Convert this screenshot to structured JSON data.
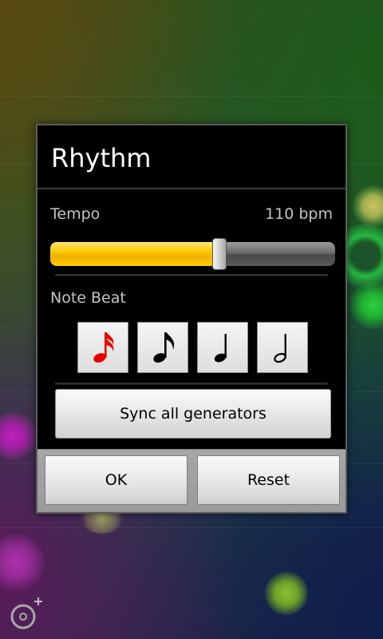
{
  "dialog": {
    "title": "Rhythm",
    "tempo": {
      "label": "Tempo",
      "value_text": "110 bpm",
      "slider_fraction": 0.595
    },
    "note_beat": {
      "label": "Note Beat",
      "selected": "sixteenth-note",
      "options": [
        "sixteenth-note",
        "eighth-note",
        "quarter-note",
        "half-note"
      ]
    },
    "sync_label": "Sync all generators",
    "buttons": {
      "ok_label": "OK",
      "reset_label": "Reset"
    }
  },
  "colors": {
    "slider_fill": "#ffcc00",
    "selected_note": "#e80000",
    "note": "#000000",
    "dialog_bg": "#000000"
  },
  "icons": {
    "add_node": "add-node-icon"
  }
}
